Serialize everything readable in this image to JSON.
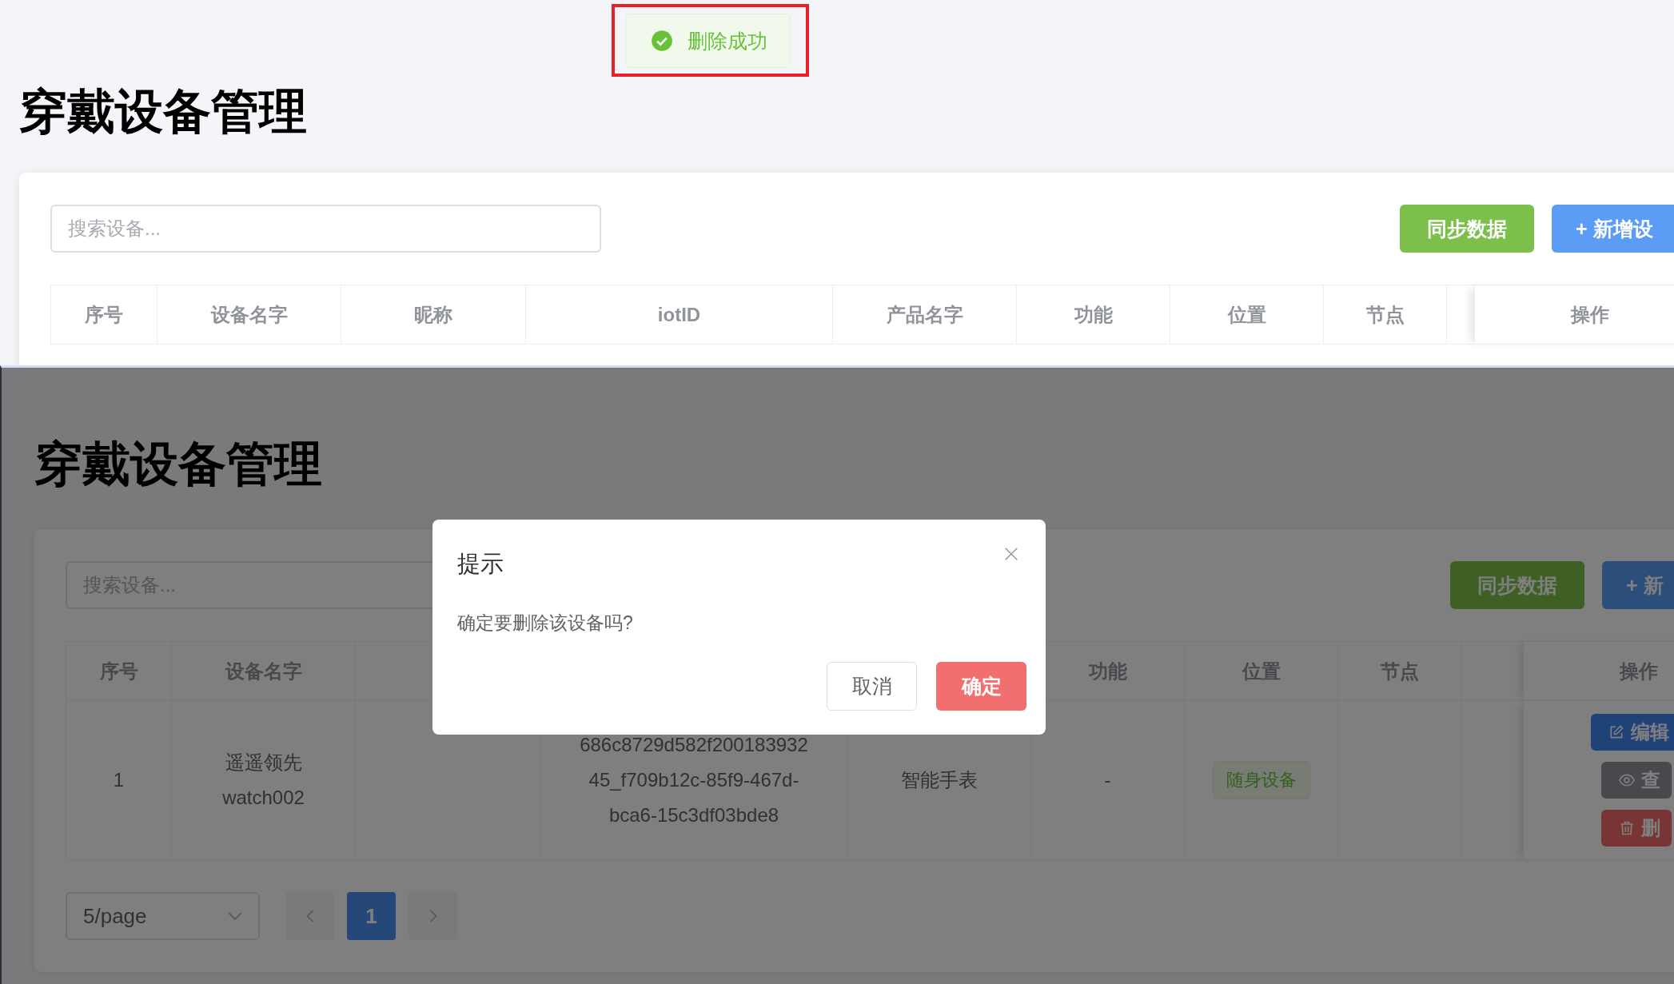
{
  "toast": {
    "kind": "success",
    "message": "删除成功",
    "highlighted": true
  },
  "screens": [
    {
      "dimmed": false,
      "title": "穿戴设备管理",
      "search": {
        "placeholder": "搜索设备..."
      },
      "buttons": [
        {
          "kind": "sync",
          "label": "同步数据"
        },
        {
          "kind": "add",
          "label": "+ 新增设"
        }
      ],
      "table": {
        "columns": [
          {
            "label": "序号"
          },
          {
            "label": "设备名字"
          },
          {
            "label": "昵称"
          },
          {
            "label": "iotID"
          },
          {
            "label": "产品名字"
          },
          {
            "label": "功能"
          },
          {
            "label": "位置"
          },
          {
            "label": "节点"
          },
          {
            "label": "操作"
          }
        ]
      }
    },
    {
      "dimmed": true,
      "title": "穿戴设备管理",
      "search": {
        "placeholder": "搜索设备..."
      },
      "buttons": [
        {
          "kind": "sync",
          "label": "同步数据"
        },
        {
          "kind": "add",
          "label": "+ 新"
        }
      ],
      "table": {
        "columns": [
          {
            "label": "序号"
          },
          {
            "label": "设备名字"
          },
          {},
          {},
          {},
          {
            "label": "功能"
          },
          {
            "label": "位置"
          },
          {
            "label": "节点"
          },
          {
            "label": "操作"
          }
        ],
        "rows": [
          {
            "index": "1",
            "device_name": "遥遥领先watch002",
            "iot_id": "686c8729d582f20018393245_f709b12c-85f9-467d-bca6-15c3df03bde8",
            "product_name": "智能手表",
            "function": "-",
            "location": "随身设备",
            "actions": [
              {
                "kind": "edit",
                "label": "编辑"
              },
              {
                "kind": "view",
                "label": "查"
              },
              {
                "kind": "delete",
                "label": "删"
              }
            ]
          }
        ]
      },
      "pagination": {
        "page_size": "5/page",
        "pages": [
          {
            "label": "1",
            "selected": true
          }
        ]
      },
      "dialog": {
        "title": "提示",
        "message": "确定要删除该设备吗?",
        "buttons": [
          {
            "kind": "cancel",
            "label": "取消"
          },
          {
            "kind": "confirm",
            "label": "确定"
          }
        ]
      }
    }
  ]
}
